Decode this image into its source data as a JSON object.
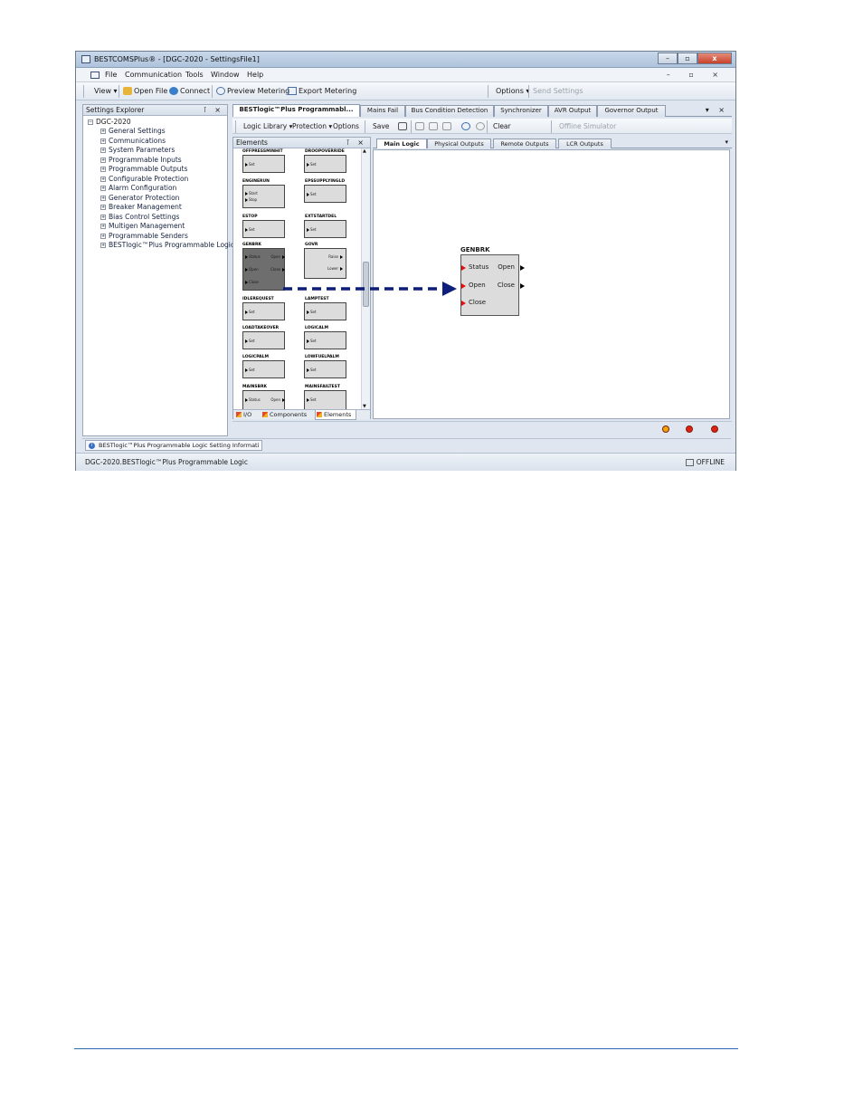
{
  "window": {
    "title": "BESTCOMSPlus® - [DGC-2020 - SettingsFile1]",
    "controls": [
      "–",
      "▫",
      "x"
    ],
    "menubar_controls": "– ▫ ×"
  },
  "menu": [
    "File",
    "Communication",
    "Tools",
    "Window",
    "Help"
  ],
  "toolbar": {
    "view": "View ▾",
    "open_file": "Open File",
    "connect": "Connect",
    "preview_metering": "Preview Metering",
    "export_metering": "Export Metering",
    "options": "Options ▾",
    "send_settings": "Send Settings"
  },
  "explorer": {
    "title": "Settings Explorer",
    "pin": "⊺ ×",
    "root": "DGC-2020",
    "items": [
      "General Settings",
      "Communications",
      "System Parameters",
      "Programmable Inputs",
      "Programmable Outputs",
      "Configurable Protection",
      "Alarm Configuration",
      "Generator Protection",
      "Breaker Management",
      "Bias Control Settings",
      "Multigen Management",
      "Programmable Senders",
      "BESTlogic™Plus Programmable Logic"
    ]
  },
  "doc_tabs": {
    "items": [
      "BESTlogic™Plus Programmabl...",
      "Mains Fail",
      "Bus Condition Detection",
      "Synchronizer",
      "AVR Output",
      "Governor Output"
    ],
    "controls": "▾ ×"
  },
  "logic_toolbar": {
    "logic_library": "Logic Library ▾",
    "protection": "Protection ▾",
    "options": "Options",
    "save": "Save",
    "clear": "Clear",
    "offline_simulator": "Offline Simulator",
    "icons": [
      "print-icon",
      "cut-icon",
      "copy-icon",
      "paste-icon",
      "undo-icon",
      "redo-icon"
    ]
  },
  "elements_panel": {
    "title": "Elements",
    "controls": "⊺ ×",
    "blocks": [
      {
        "title": "OFFPRESSMINHIT",
        "pins": [
          "Set"
        ]
      },
      {
        "title": "DROOPOVERRIDE",
        "pins": [
          "Set"
        ]
      },
      {
        "title": "ENGINERUN",
        "pins": [
          "Start",
          "Stop"
        ]
      },
      {
        "title": "EPSSUPPLYINGLD",
        "pins": [
          "Set"
        ]
      },
      {
        "title": "ESTOP",
        "pins": [
          "Set"
        ]
      },
      {
        "title": "EXTSTARTDEL",
        "pins": [
          "Set"
        ]
      },
      {
        "title": "GENBRK",
        "pins": [
          "Status",
          "Open",
          "Close"
        ],
        "outs": [
          "Open",
          "Close"
        ]
      },
      {
        "title": "GOVR",
        "pins": [],
        "outs": [
          "Raise",
          "Lower"
        ]
      },
      {
        "title": "IDLEREQUEST",
        "pins": [
          "Set"
        ]
      },
      {
        "title": "LAMPTEST",
        "pins": [
          "Set"
        ]
      },
      {
        "title": "LOADTAKEOVER",
        "pins": [
          "Set"
        ]
      },
      {
        "title": "LOGICALM",
        "pins": [
          "Set"
        ]
      },
      {
        "title": "LOGICPALM",
        "pins": [
          "Set"
        ]
      },
      {
        "title": "LOWFUELPALM",
        "pins": [
          "Set"
        ]
      },
      {
        "title": "MAINSBRK",
        "pins": [
          "Status"
        ],
        "outs": [
          "Open"
        ]
      },
      {
        "title": "MAINSFAILTEST",
        "pins": [
          "Set"
        ]
      }
    ],
    "bottom_tabs": [
      "I/O",
      "Components",
      "Elements"
    ]
  },
  "sub_tabs": [
    "Main Logic",
    "Physical Outputs",
    "Remote Outputs",
    "LCR Outputs"
  ],
  "sub_tabs_arrow": "▾",
  "canvas_block": {
    "title": "GENBRK",
    "inputs": [
      "Status",
      "Open",
      "Close"
    ],
    "outputs": [
      "Open",
      "Close"
    ]
  },
  "status_dots": {
    "colors": [
      "#f2a400",
      "#e02010",
      "#e02010"
    ]
  },
  "info_tab": {
    "icon": "i",
    "label": "BESTlogic™Plus Programmable Logic Setting Informati"
  },
  "statusbar": {
    "path": "DGC-2020.BESTlogic™Plus Programmable Logic",
    "state": "OFFLINE"
  },
  "colors": {
    "accent_selected": "#3399ff",
    "arrow": "#0d1f7a",
    "pin_red": "#e01010"
  }
}
